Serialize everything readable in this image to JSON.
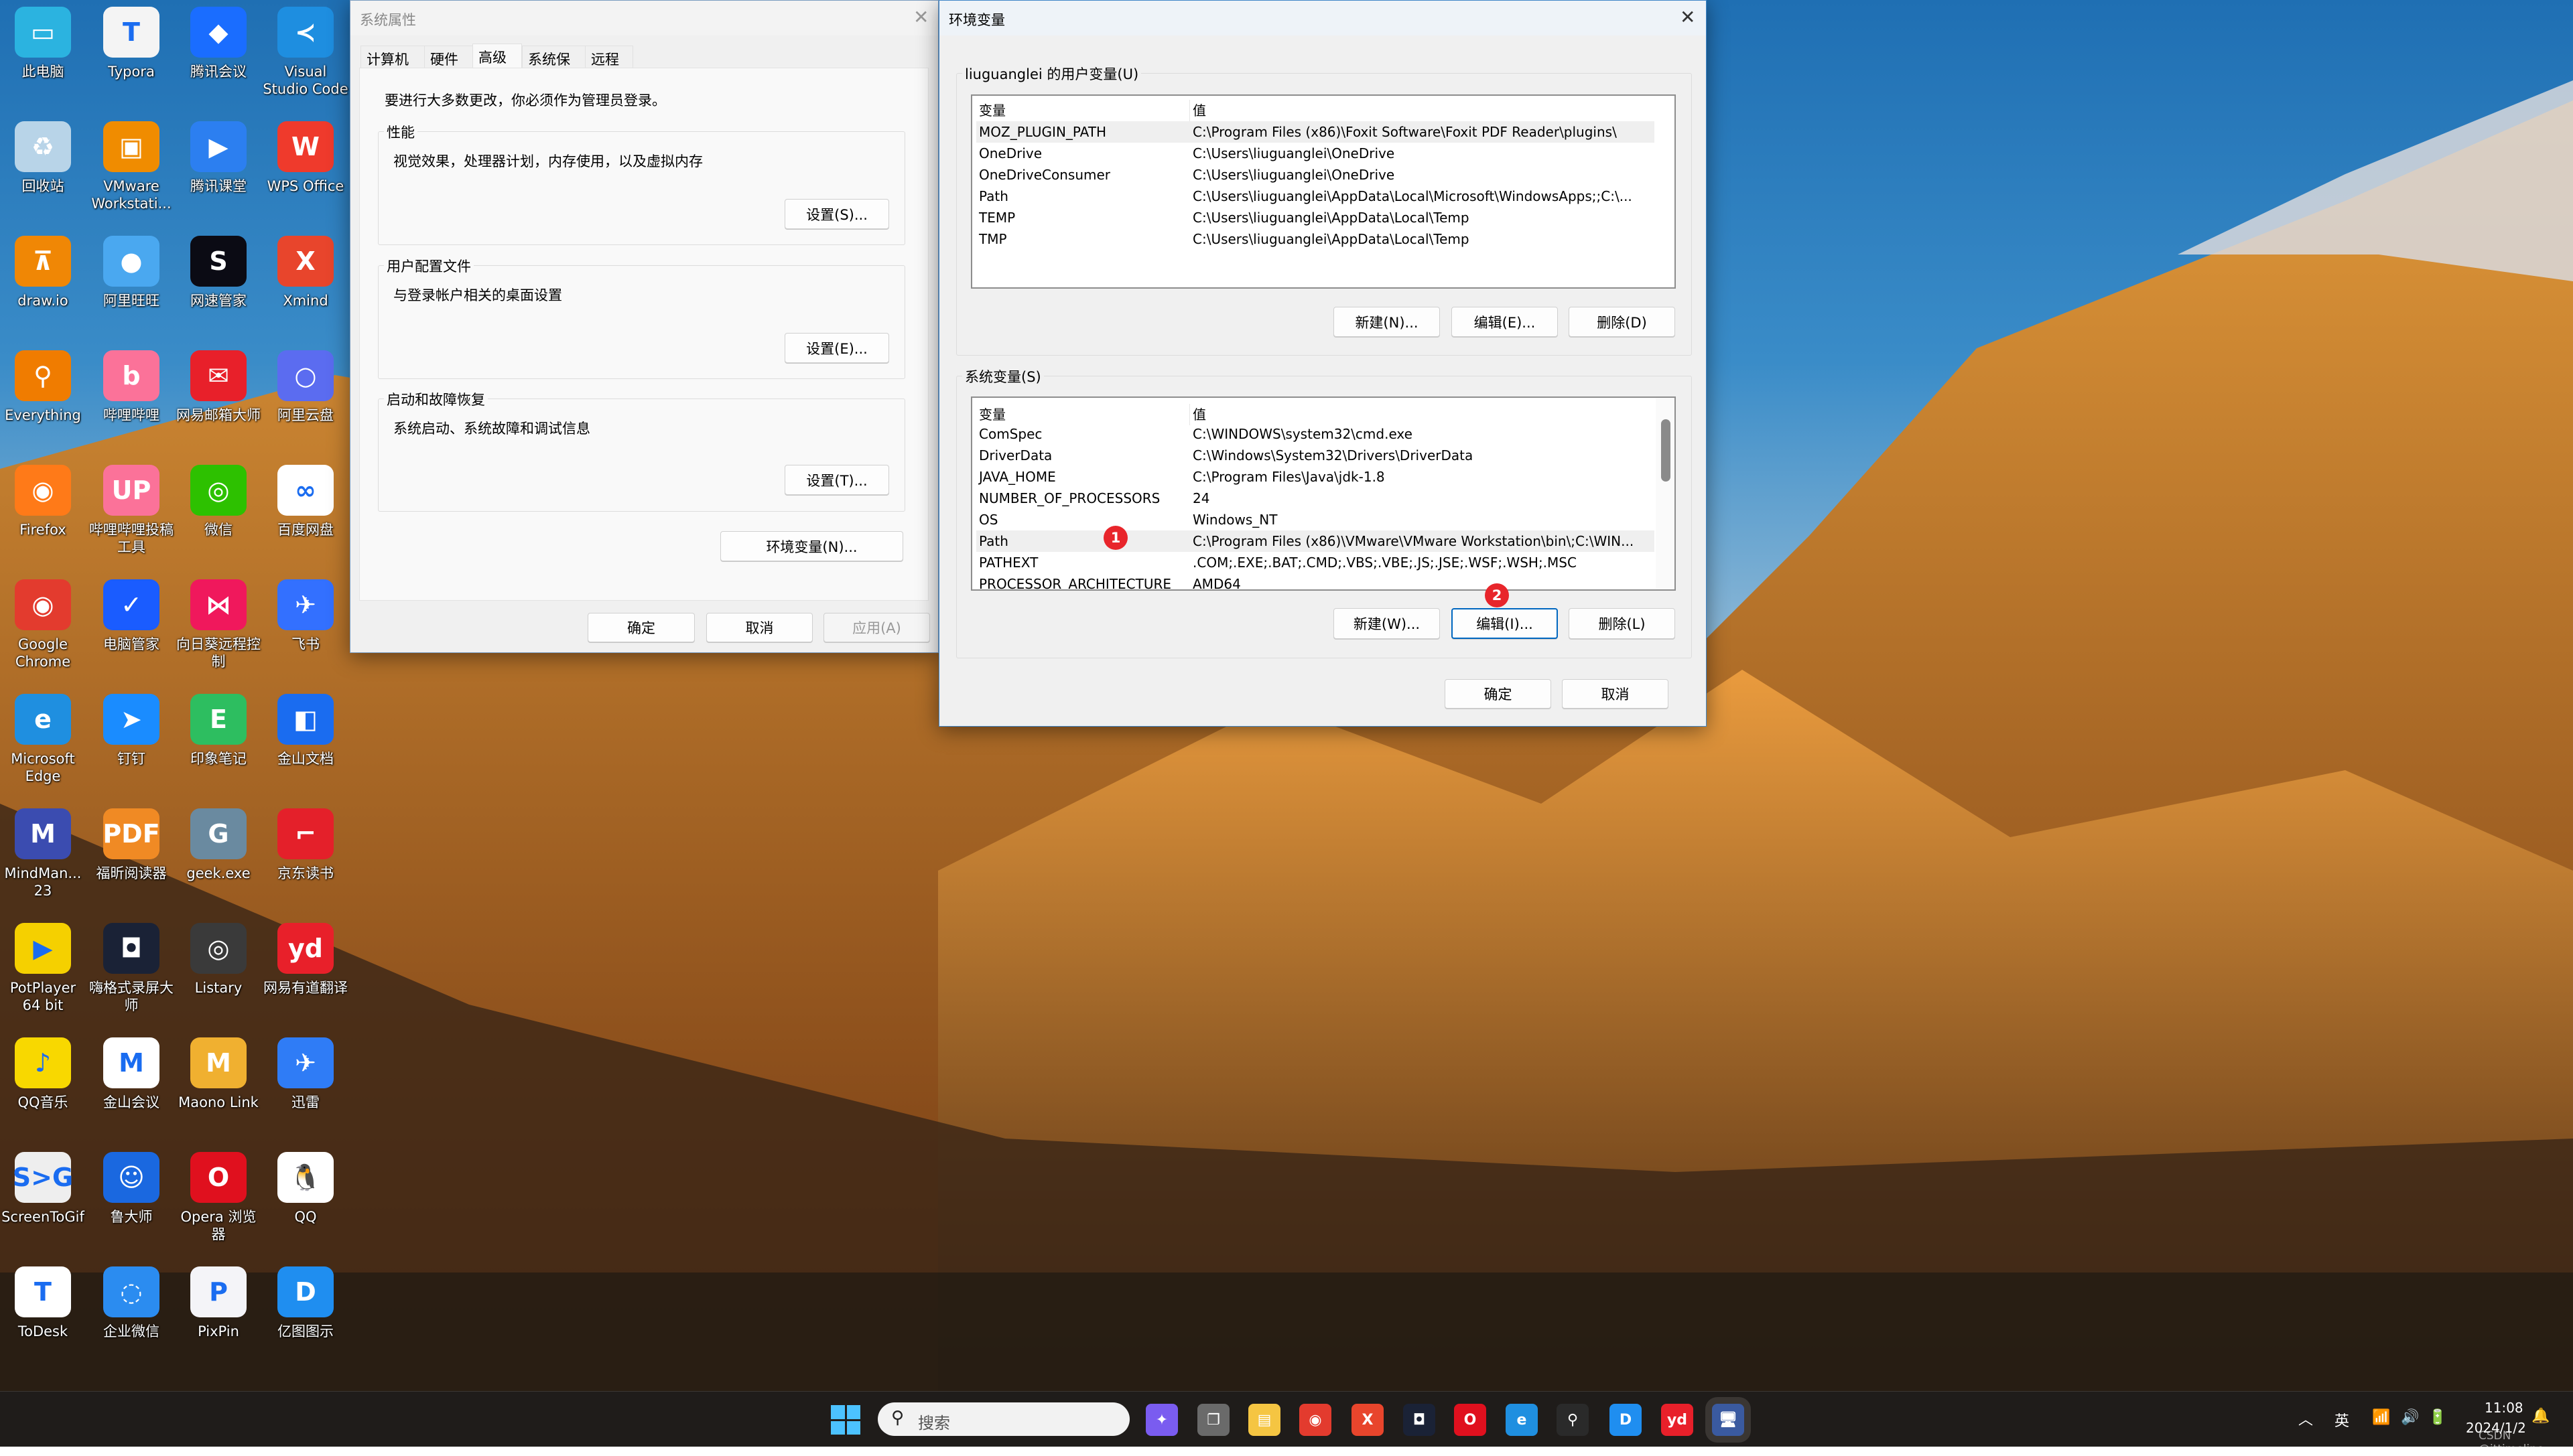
{
  "desktop": {
    "icons": [
      {
        "label": "此电脑",
        "icon": "this-pc",
        "color": "#2bb3e0",
        "glyph": "▭"
      },
      {
        "label": "Typora",
        "icon": "typora",
        "color": "#f4f4f4",
        "glyph": "T"
      },
      {
        "label": "腾讯会议",
        "icon": "tencent-meeting",
        "color": "#1a6dff",
        "glyph": "◆"
      },
      {
        "label": "Visual Studio Code",
        "icon": "vscode",
        "color": "#1e8ee0",
        "glyph": "≺"
      },
      {
        "label": "回收站",
        "icon": "recycle-bin",
        "color": "#b8d4e8",
        "glyph": "♻"
      },
      {
        "label": "VMware Workstati...",
        "icon": "vmware",
        "color": "#f08c00",
        "glyph": "▣"
      },
      {
        "label": "腾讯课堂",
        "icon": "tencent-classroom",
        "color": "#2c7ff0",
        "glyph": "▶"
      },
      {
        "label": "WPS Office",
        "icon": "wps",
        "color": "#ef3a2c",
        "glyph": "W"
      },
      {
        "label": "draw.io",
        "icon": "drawio",
        "color": "#f08705",
        "glyph": "⊼"
      },
      {
        "label": "阿里旺旺",
        "icon": "aliwangwang",
        "color": "#4aa8f0",
        "glyph": "●"
      },
      {
        "label": "网速管家",
        "icon": "netspeed",
        "color": "#0b0b14",
        "glyph": "S"
      },
      {
        "label": "Xmind",
        "icon": "xmind",
        "color": "#e8452c",
        "glyph": "X"
      },
      {
        "label": "Everything",
        "icon": "everything",
        "color": "#f07c00",
        "glyph": "⚲"
      },
      {
        "label": "哔哩哔哩",
        "icon": "bilibili",
        "color": "#fb7299",
        "glyph": "b"
      },
      {
        "label": "网易邮箱大师",
        "icon": "netease-mail",
        "color": "#e8202a",
        "glyph": "✉"
      },
      {
        "label": "阿里云盘",
        "icon": "aliyun-drive",
        "color": "#5b6cf0",
        "glyph": "○"
      },
      {
        "label": "Firefox",
        "icon": "firefox",
        "color": "#ff7a18",
        "glyph": "◉"
      },
      {
        "label": "哔哩哔哩投稿工具",
        "icon": "bilibili-upload",
        "color": "#fb7299",
        "glyph": "UP"
      },
      {
        "label": "微信",
        "icon": "wechat",
        "color": "#2dc100",
        "glyph": "◎"
      },
      {
        "label": "百度网盘",
        "icon": "baidu-netdisk",
        "color": "#ffffff",
        "glyph": "∞"
      },
      {
        "label": "Google Chrome",
        "icon": "chrome",
        "color": "#e33b2e",
        "glyph": "◉"
      },
      {
        "label": "电脑管家",
        "icon": "pc-manager",
        "color": "#1a5cff",
        "glyph": "✓"
      },
      {
        "label": "向日葵远程控制",
        "icon": "sunlogin",
        "color": "#f0185c",
        "glyph": "⋈"
      },
      {
        "label": "飞书",
        "icon": "feishu",
        "color": "#3370ff",
        "glyph": "✈"
      },
      {
        "label": "Microsoft Edge",
        "icon": "edge",
        "color": "#1f8fe0",
        "glyph": "e"
      },
      {
        "label": "钉钉",
        "icon": "dingtalk",
        "color": "#1a8cff",
        "glyph": "➤"
      },
      {
        "label": "印象笔记",
        "icon": "evernote",
        "color": "#2dbe60",
        "glyph": "E"
      },
      {
        "label": "金山文档",
        "icon": "kdocs",
        "color": "#1a6cf0",
        "glyph": "◧"
      },
      {
        "label": "MindMan... 23",
        "icon": "mindmanager",
        "color": "#3b4cb0",
        "glyph": "M"
      },
      {
        "label": "福昕阅读器",
        "icon": "foxit",
        "color": "#f08a24",
        "glyph": "PDF"
      },
      {
        "label": "geek.exe",
        "icon": "geek",
        "color": "#6a8aa0",
        "glyph": "G"
      },
      {
        "label": "京东读书",
        "icon": "jd-read",
        "color": "#e4202a",
        "glyph": "⌐"
      },
      {
        "label": "PotPlayer 64 bit",
        "icon": "potplayer",
        "color": "#f5d000",
        "glyph": "▶"
      },
      {
        "label": "嗨格式录屏大师",
        "icon": "screen-recorder",
        "color": "#1a2236",
        "glyph": "◘"
      },
      {
        "label": "Listary",
        "icon": "listary",
        "color": "#3a3a3a",
        "glyph": "◎"
      },
      {
        "label": "网易有道翻译",
        "icon": "youdao",
        "color": "#e8202a",
        "glyph": "yd"
      },
      {
        "label": "QQ音乐",
        "icon": "qq-music",
        "color": "#f8d800",
        "glyph": "♪"
      },
      {
        "label": "金山会议",
        "icon": "kmeeting",
        "color": "#ffffff",
        "glyph": "M"
      },
      {
        "label": "Maono Link",
        "icon": "maono",
        "color": "#f0b030",
        "glyph": "M"
      },
      {
        "label": "迅雷",
        "icon": "xunlei",
        "color": "#2f7cf6",
        "glyph": "✈"
      },
      {
        "label": "ScreenToGif",
        "icon": "screentogif",
        "color": "#eeeeee",
        "glyph": "S>G"
      },
      {
        "label": "鲁大师",
        "icon": "ludashi",
        "color": "#1a68e0",
        "glyph": "☺"
      },
      {
        "label": "Opera 浏览器",
        "icon": "opera",
        "color": "#e0101e",
        "glyph": "O"
      },
      {
        "label": "QQ",
        "icon": "qq",
        "color": "#ffffff",
        "glyph": "🐧"
      },
      {
        "label": "ToDesk",
        "icon": "todesk",
        "color": "#ffffff",
        "glyph": "T"
      },
      {
        "label": "企业微信",
        "icon": "wecom",
        "color": "#2b8cf0",
        "glyph": "◌"
      },
      {
        "label": "PixPin",
        "icon": "pixpin",
        "color": "#f4f4f8",
        "glyph": "P"
      },
      {
        "label": "亿图图示",
        "icon": "edraw",
        "color": "#1f8ef0",
        "glyph": "D"
      }
    ]
  },
  "system_properties": {
    "title": "系统属性",
    "tabs": [
      "计算机名",
      "硬件",
      "高级",
      "系统保护",
      "远程"
    ],
    "active_tab": "高级",
    "admin_note": "要进行大多数更改，你必须作为管理员登录。",
    "groups": [
      {
        "title": "性能",
        "desc": "视觉效果，处理器计划，内存使用，以及虚拟内存",
        "button": "设置(S)..."
      },
      {
        "title": "用户配置文件",
        "desc": "与登录帐户相关的桌面设置",
        "button": "设置(E)..."
      },
      {
        "title": "启动和故障恢复",
        "desc": "系统启动、系统故障和调试信息",
        "button": "设置(T)..."
      }
    ],
    "env_button": "环境变量(N)...",
    "ok": "确定",
    "cancel": "取消",
    "apply": "应用(A)"
  },
  "env_vars": {
    "title": "环境变量",
    "user_group": "liuguanglei 的用户变量(U)",
    "col_var": "变量",
    "col_val": "值",
    "user_vars": [
      {
        "name": "MOZ_PLUGIN_PATH",
        "value": "C:\\Program Files (x86)\\Foxit Software\\Foxit PDF Reader\\plugins\\"
      },
      {
        "name": "OneDrive",
        "value": "C:\\Users\\liuguanglei\\OneDrive"
      },
      {
        "name": "OneDriveConsumer",
        "value": "C:\\Users\\liuguanglei\\OneDrive"
      },
      {
        "name": "Path",
        "value": "C:\\Users\\liuguanglei\\AppData\\Local\\Microsoft\\WindowsApps;;C:\\..."
      },
      {
        "name": "TEMP",
        "value": "C:\\Users\\liuguanglei\\AppData\\Local\\Temp"
      },
      {
        "name": "TMP",
        "value": "C:\\Users\\liuguanglei\\AppData\\Local\\Temp"
      }
    ],
    "user_buttons": [
      "新建(N)...",
      "编辑(E)...",
      "删除(D)"
    ],
    "system_group": "系统变量(S)",
    "system_vars": [
      {
        "name": "ComSpec",
        "value": "C:\\WINDOWS\\system32\\cmd.exe"
      },
      {
        "name": "DriverData",
        "value": "C:\\Windows\\System32\\Drivers\\DriverData"
      },
      {
        "name": "JAVA_HOME",
        "value": "C:\\Program Files\\Java\\jdk-1.8"
      },
      {
        "name": "NUMBER_OF_PROCESSORS",
        "value": "24"
      },
      {
        "name": "OS",
        "value": "Windows_NT"
      },
      {
        "name": "Path",
        "value": "C:\\Program Files (x86)\\VMware\\VMware Workstation\\bin\\;C:\\WIN..."
      },
      {
        "name": "PATHEXT",
        "value": ".COM;.EXE;.BAT;.CMD;.VBS;.VBE;.JS;.JSE;.WSF;.WSH;.MSC"
      },
      {
        "name": "PROCESSOR_ARCHITECTURE",
        "value": "AMD64"
      }
    ],
    "selected_system_var": "Path",
    "system_buttons": [
      "新建(W)...",
      "编辑(I)...",
      "删除(L)"
    ],
    "ok": "确定",
    "cancel": "取消",
    "badges": [
      "1",
      "2"
    ],
    "badge_color": "#e8252b",
    "accent": "#0067c0"
  },
  "taskbar": {
    "search_placeholder": "搜索",
    "apps": [
      {
        "icon": "copilot",
        "color": "#7a5cf0",
        "glyph": "✦"
      },
      {
        "icon": "task-view",
        "color": "#6a6a6a",
        "glyph": "❐"
      },
      {
        "icon": "file-explorer",
        "color": "#f5c542",
        "glyph": "▤"
      },
      {
        "icon": "chrome",
        "color": "#e33b2e",
        "glyph": "◉"
      },
      {
        "icon": "xmind",
        "color": "#e8452c",
        "glyph": "X"
      },
      {
        "icon": "screen-recorder",
        "color": "#1a2236",
        "glyph": "◘"
      },
      {
        "icon": "opera",
        "color": "#e0101e",
        "glyph": "O"
      },
      {
        "icon": "edge",
        "color": "#1f8fe0",
        "glyph": "e"
      },
      {
        "icon": "everything",
        "color": "#2a2a2a",
        "glyph": "⚲"
      },
      {
        "icon": "edraw",
        "color": "#1f8ef0",
        "glyph": "D"
      },
      {
        "icon": "youdao",
        "color": "#e8202a",
        "glyph": "yd"
      },
      {
        "icon": "system-properties",
        "color": "#3a5aa0",
        "glyph": "🖥"
      }
    ],
    "tray": {
      "ime": "英",
      "time": "11:08",
      "date": "2024/1/2"
    },
    "watermark": "CSDN @ittimeline"
  }
}
